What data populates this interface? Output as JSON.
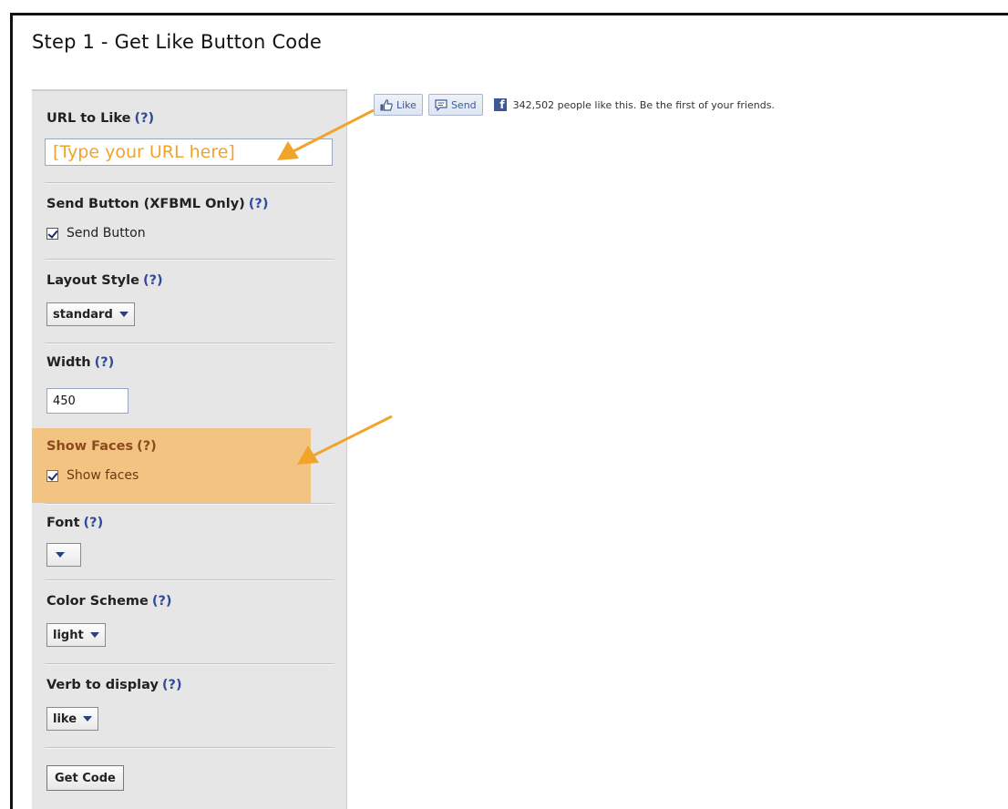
{
  "page": {
    "title": "Step 1 - Get Like Button Code"
  },
  "form": {
    "help_marker": "(?)",
    "url": {
      "label": "URL to Like",
      "placeholder": "[Type your URL here]"
    },
    "send": {
      "label": "Send Button (XFBML Only)",
      "checkbox_label": "Send Button",
      "checked": true
    },
    "layout": {
      "label": "Layout Style",
      "value": "standard"
    },
    "width": {
      "label": "Width",
      "value": "450"
    },
    "faces": {
      "label": "Show Faces",
      "checkbox_label": "Show faces",
      "checked": true
    },
    "font": {
      "label": "Font",
      "value": ""
    },
    "color_scheme": {
      "label": "Color Scheme",
      "value": "light"
    },
    "verb": {
      "label": "Verb to display",
      "value": "like"
    },
    "submit_label": "Get Code"
  },
  "preview": {
    "like_label": "Like",
    "send_label": "Send",
    "social_text": "342,502 people like this. Be the first of your friends."
  },
  "colors": {
    "highlight": "#f3c381",
    "arrow": "#f0a42a",
    "link_blue": "#2f4a9c",
    "facebook_blue": "#3b5998"
  },
  "icons": [
    "thumbs-up-icon",
    "speech-bubble-icon",
    "facebook-logo-icon",
    "checkbox-icon",
    "chevron-down-icon",
    "arrow-annotation-icon"
  ]
}
